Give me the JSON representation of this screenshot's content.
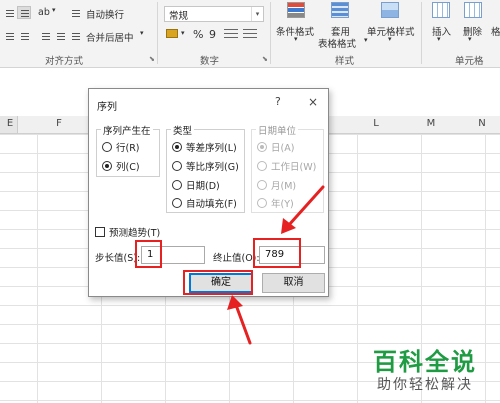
{
  "ribbon": {
    "wrap_text": "自动换行",
    "merge_center": "合并后居中",
    "alignment_group": "对齐方式",
    "number_format": "常规",
    "percent": "%",
    "comma": "9",
    "number_group": "数字",
    "conditional_format": "条件格式",
    "table_format_line1": "套用",
    "table_format_line2": "表格格式",
    "cell_style": "单元格样式",
    "styles_group": "样式",
    "insert": "插入",
    "delete": "删除",
    "format_partial": "格",
    "cells_group": "单元格",
    "orientation_glyph": "ab"
  },
  "columns": [
    "E",
    "F",
    "L",
    "M",
    "N"
  ],
  "dialog": {
    "title": "序列",
    "help": "?",
    "close": "×",
    "series_in": {
      "legend": "序列产生在",
      "options": [
        {
          "label": "行(R)",
          "selected": false
        },
        {
          "label": "列(C)",
          "selected": true
        }
      ]
    },
    "type": {
      "legend": "类型",
      "options": [
        {
          "label": "等差序列(L)",
          "selected": true
        },
        {
          "label": "等比序列(G)",
          "selected": false
        },
        {
          "label": "日期(D)",
          "selected": false
        },
        {
          "label": "自动填充(F)",
          "selected": false
        }
      ]
    },
    "date_unit": {
      "legend": "日期单位",
      "options": [
        {
          "label": "日(A)",
          "selected": true
        },
        {
          "label": "工作日(W)",
          "selected": false
        },
        {
          "label": "月(M)",
          "selected": false
        },
        {
          "label": "年(Y)",
          "selected": false
        }
      ]
    },
    "trend": {
      "label": "预测趋势(T)",
      "checked": false
    },
    "step": {
      "label": "步长值(S):",
      "value": "1"
    },
    "stop": {
      "label": "终止值(O):",
      "value": "789"
    },
    "ok": "确定",
    "cancel": "取消"
  },
  "watermark": {
    "main": "百科全说",
    "sub": "助你轻松解决"
  },
  "colors": {
    "highlight": "#e52121",
    "accent": "#0078d7",
    "watermark_green": "#1f9b43"
  }
}
